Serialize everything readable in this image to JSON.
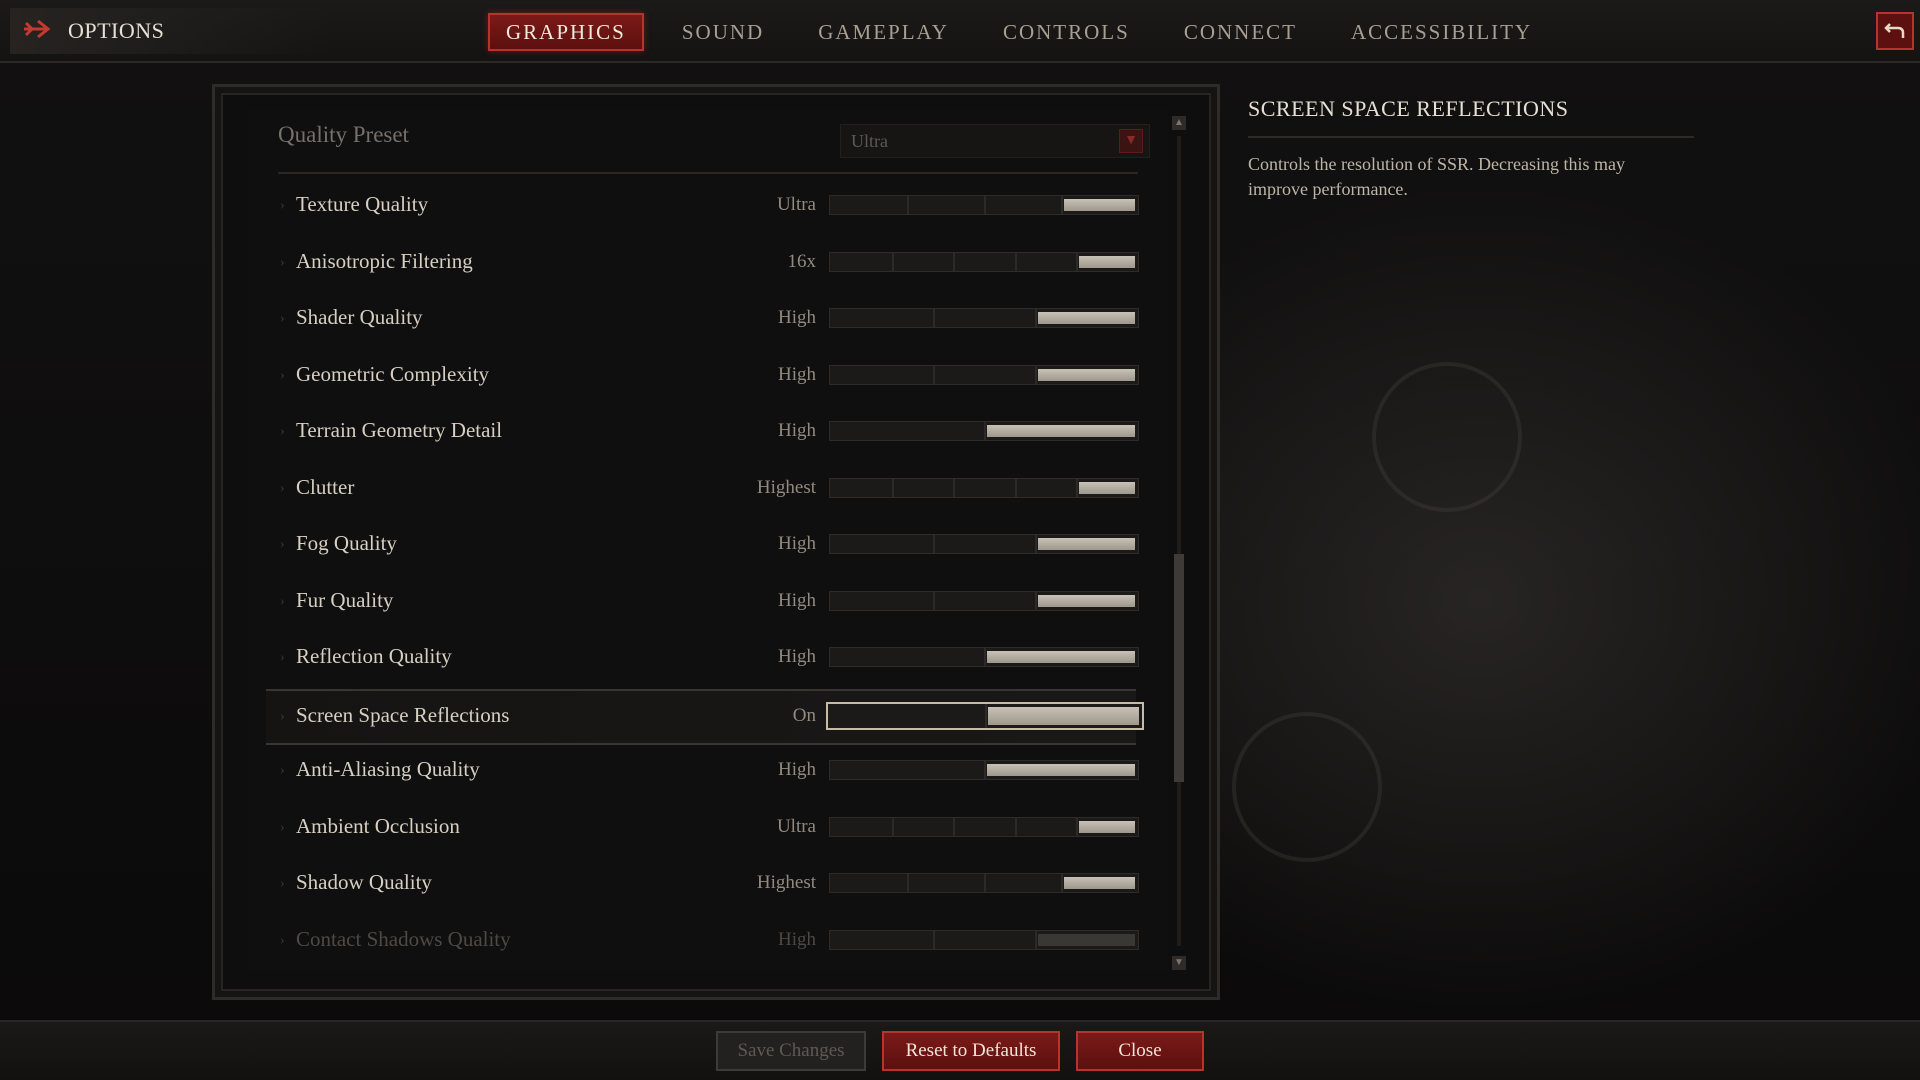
{
  "header": {
    "title": "OPTIONS",
    "tabs": [
      {
        "label": "GRAPHICS",
        "active": true
      },
      {
        "label": "SOUND",
        "active": false
      },
      {
        "label": "GAMEPLAY",
        "active": false
      },
      {
        "label": "CONTROLS",
        "active": false
      },
      {
        "label": "CONNECT",
        "active": false
      },
      {
        "label": "ACCESSIBILITY",
        "active": false
      }
    ]
  },
  "preset": {
    "label": "Quality Preset",
    "value": "Ultra"
  },
  "settings": [
    {
      "label": "Texture Quality",
      "value": "Ultra",
      "steps": 4,
      "level": 1
    },
    {
      "label": "Anisotropic Filtering",
      "value": "16x",
      "steps": 5,
      "level": 1
    },
    {
      "label": "Shader Quality",
      "value": "High",
      "steps": 3,
      "level": 1
    },
    {
      "label": "Geometric Complexity",
      "value": "High",
      "steps": 3,
      "level": 1
    },
    {
      "label": "Terrain Geometry Detail",
      "value": "High",
      "steps": 2,
      "level": 1
    },
    {
      "label": "Clutter",
      "value": "Highest",
      "steps": 5,
      "level": 1
    },
    {
      "label": "Fog Quality",
      "value": "High",
      "steps": 3,
      "level": 1
    },
    {
      "label": "Fur Quality",
      "value": "High",
      "steps": 3,
      "level": 1
    },
    {
      "label": "Reflection Quality",
      "value": "High",
      "steps": 2,
      "level": 1
    },
    {
      "label": "Screen Space Reflections",
      "value": "On",
      "steps": 2,
      "level": 1,
      "selected": true
    },
    {
      "label": "Anti-Aliasing Quality",
      "value": "High",
      "steps": 2,
      "level": 1
    },
    {
      "label": "Ambient Occlusion",
      "value": "Ultra",
      "steps": 5,
      "level": 1
    },
    {
      "label": "Shadow Quality",
      "value": "Highest",
      "steps": 4,
      "level": 1
    },
    {
      "label": "Contact Shadows Quality",
      "value": "High",
      "steps": 3,
      "level": 1,
      "dim": true
    }
  ],
  "description": {
    "title": "SCREEN SPACE REFLECTIONS",
    "text": "Controls the resolution of SSR. Decreasing this may improve performance."
  },
  "footer": {
    "save": "Save Changes",
    "reset": "Reset to Defaults",
    "close": "Close"
  },
  "colors": {
    "accent": "#b8332d",
    "accent_fill": "#6b1513",
    "slider_fill": "#c8c1b5"
  },
  "icons": {
    "options": "arrow-right-icon",
    "back": "return-arrow-icon",
    "dropdown": "triangle-down-icon"
  }
}
